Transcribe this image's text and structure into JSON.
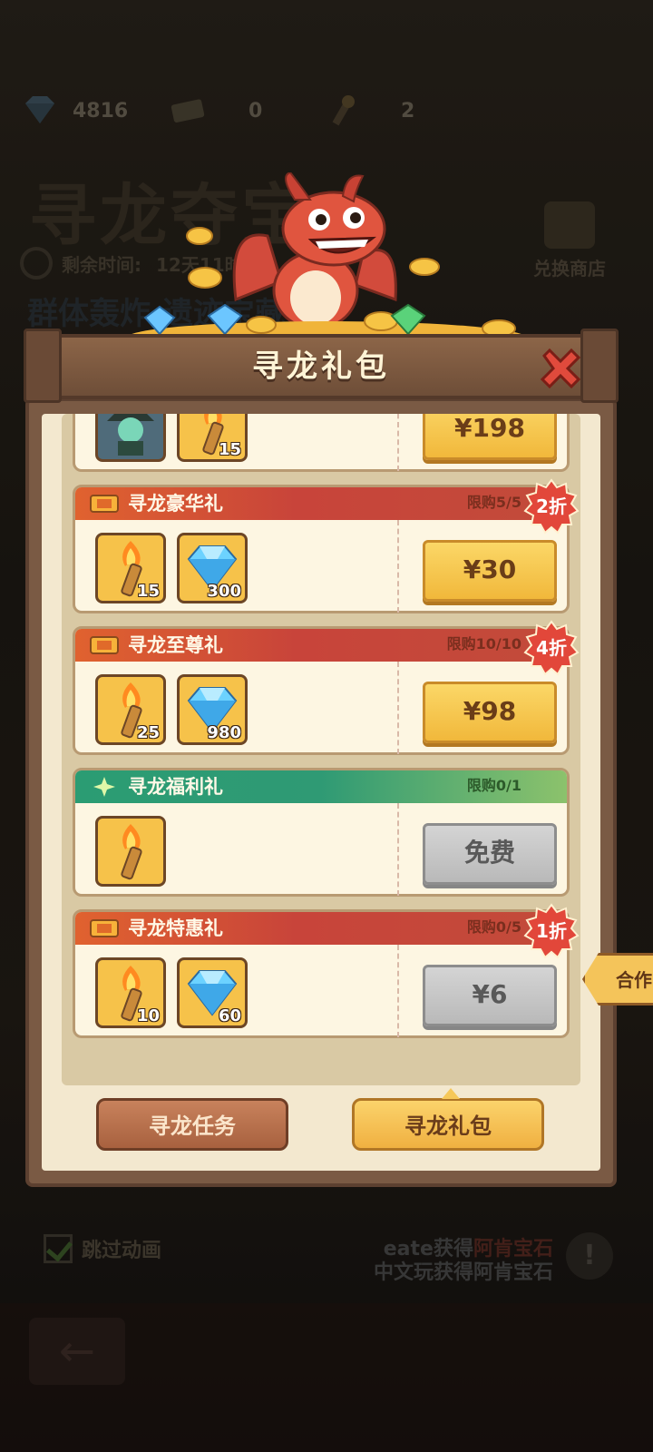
{
  "background": {
    "resources": [
      {
        "icon": "diamond-icon",
        "value": "4816"
      },
      {
        "icon": "ticket-icon",
        "value": "0"
      },
      {
        "icon": "torch-icon",
        "value": "2"
      }
    ],
    "event_title": "寻龙夺宝",
    "timer_label": "剩余时间:",
    "timer_value": "12天11时",
    "subtitle": "群体轰炸·遗迹宝藏",
    "shop_label": "兑换商店",
    "skip_animation": "跳过动画",
    "log_line1_prefix": "eate获得",
    "log_line1_item": "阿肯宝石",
    "log_line2": "中文玩获得阿肯宝石"
  },
  "panel": {
    "title": "寻龙礼包",
    "packages": [
      {
        "name": "",
        "items": [
          {
            "icon": "witch-hero-icon",
            "qty": ""
          },
          {
            "icon": "torch-icon",
            "qty": "15"
          }
        ],
        "price": "¥198",
        "style": "gold"
      },
      {
        "name": "寻龙豪华礼",
        "limit": "限购5/5",
        "discount": "2折",
        "items": [
          {
            "icon": "torch-icon",
            "qty": "15"
          },
          {
            "icon": "diamond-icon",
            "qty": "300"
          }
        ],
        "price": "¥30",
        "style": "gold"
      },
      {
        "name": "寻龙至尊礼",
        "limit": "限购10/10",
        "discount": "4折",
        "items": [
          {
            "icon": "torch-icon",
            "qty": "25"
          },
          {
            "icon": "diamond-icon",
            "qty": "980"
          }
        ],
        "price": "¥98",
        "style": "gold"
      },
      {
        "name": "寻龙福利礼",
        "limit": "限购0/1",
        "items": [
          {
            "icon": "torch-icon",
            "qty": ""
          }
        ],
        "price": "免费",
        "style": "gray"
      },
      {
        "name": "寻龙特惠礼",
        "limit": "限购0/5",
        "discount": "1折",
        "items": [
          {
            "icon": "torch-icon",
            "qty": "10"
          },
          {
            "icon": "diamond-icon",
            "qty": "60"
          }
        ],
        "price": "¥6",
        "style": "gray"
      }
    ],
    "tabs": [
      {
        "label": "寻龙任务",
        "active": false
      },
      {
        "label": "寻龙礼包",
        "active": true
      }
    ],
    "side_button": "合作"
  },
  "colors": {
    "band_red": "#c8443a",
    "band_green": "#2b9c73",
    "price_gold": "#f1b83b",
    "price_gray": "#b9b9b9",
    "discount_badge": "#e2473a"
  }
}
